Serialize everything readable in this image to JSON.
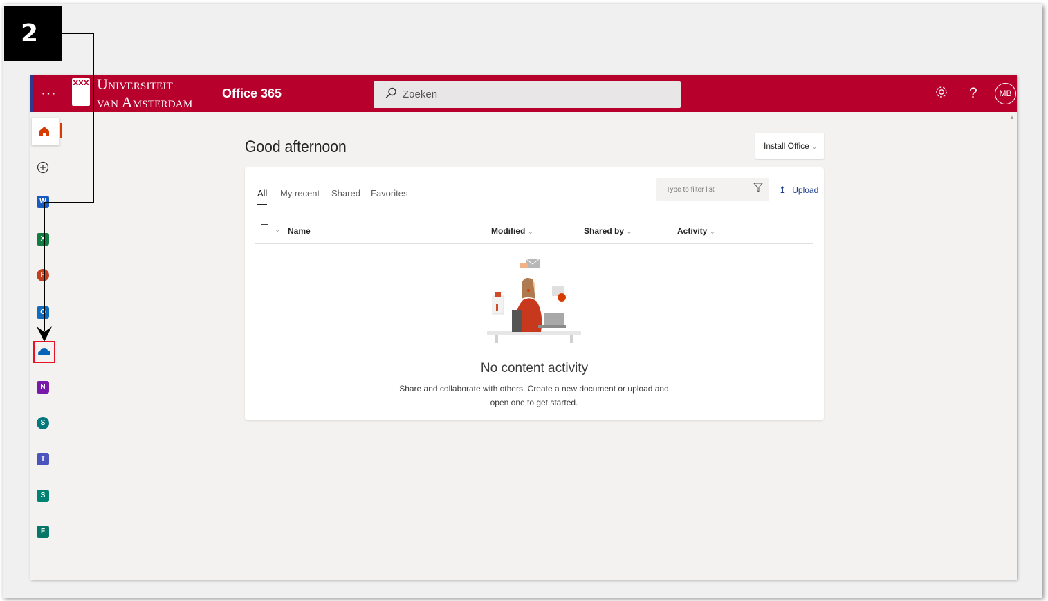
{
  "step": {
    "number": "2"
  },
  "topbar": {
    "logo_line1": "Universiteit",
    "logo_line2": "van Amsterdam",
    "logo_mark": "XXX",
    "app_title": "Office 365",
    "search_placeholder": "Zoeken",
    "avatar_initials": "MB",
    "settings_icon": "gear-icon",
    "help_label": "?"
  },
  "rail": {
    "items": [
      {
        "name": "home",
        "icon": "home-icon",
        "color": "#d83b01"
      },
      {
        "name": "create",
        "icon": "plus-circle-icon",
        "color": "#323130"
      },
      {
        "name": "word",
        "icon": "word-icon",
        "letter": "W",
        "color": "#185abd"
      },
      {
        "name": "excel",
        "icon": "excel-icon",
        "letter": "X",
        "color": "#107c41"
      },
      {
        "name": "powerpoint",
        "icon": "powerpoint-icon",
        "letter": "P",
        "color": "#c43e1c"
      },
      {
        "name": "outlook",
        "icon": "outlook-icon",
        "letter": "O",
        "color": "#0f6cbd"
      },
      {
        "name": "onedrive",
        "icon": "onedrive-icon",
        "color": "#0364b8",
        "highlighted": true
      },
      {
        "name": "onenote",
        "icon": "onenote-icon",
        "letter": "N",
        "color": "#7719aa"
      },
      {
        "name": "sharepoint",
        "icon": "sharepoint-icon",
        "letter": "S",
        "color": "#03787c"
      },
      {
        "name": "teams",
        "icon": "teams-icon",
        "letter": "T",
        "color": "#4b53bc"
      },
      {
        "name": "sway",
        "icon": "sway-icon",
        "letter": "S",
        "color": "#008272"
      },
      {
        "name": "forms",
        "icon": "forms-icon",
        "letter": "F",
        "color": "#077568"
      }
    ],
    "highlight_color": "#e81123"
  },
  "main": {
    "greeting": "Good afternoon",
    "install_office": "Install Office",
    "tabs": [
      "All",
      "My recent",
      "Shared",
      "Favorites"
    ],
    "active_tab": "All",
    "filter_placeholder": "Type to filter list",
    "upload": "Upload",
    "columns": [
      "Name",
      "Modified",
      "Shared by",
      "Activity"
    ],
    "empty_title": "No content activity",
    "empty_description": "Share and collaborate with others. Create a new document or upload and open one to get started."
  },
  "colors": {
    "brand": "#b8002d",
    "accent": "#1f3f8f"
  }
}
